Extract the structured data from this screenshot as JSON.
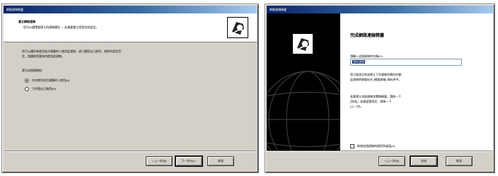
{
  "window1": {
    "title": "網路連線精靈",
    "header_title": "建立網路連線",
    "header_subtitle": "您可以選擇要建立的連線類型 — 此精靈會引導您完成設定。",
    "description_line1": "您可以讓所有使用這台電腦的人使用此連線，或只讓您自己使用，視您的設定而",
    "description_line2": "定。請選取您要如何使用此連線。",
    "group_label": "建立這個連線給：",
    "options": [
      {
        "label": "任何使用這台電腦的人使用(A)",
        "checked": true
      },
      {
        "label": "只供我自己使用(M)",
        "checked": false
      }
    ],
    "buttons": {
      "back": "< 上一步(B)",
      "next": "下一步(N) >",
      "cancel": "取消"
    }
  },
  "window2": {
    "title": "網路連線精靈",
    "heading": "完成網路連線精靈",
    "field_label": "請輸入這個連線的名稱(C):",
    "field_value": "我的連線",
    "para1_line1": "您已經成功完成建立下列連線所需的步驟：",
    "para1_line2": "此連線將會儲存在 [網路連線] 資料夾中。",
    "para2_line1": "若要建立這個連線並關閉精靈，請按一下",
    "para2_line2": "[完成]。若要變更設定，請按一下",
    "para2_line3": "[上一步]。",
    "checkbox_label": "新增這個連線的捷徑到桌面(S)",
    "buttons": {
      "back": "< 上一步(B)",
      "finish": "完成",
      "cancel": "取消"
    }
  },
  "colors": {
    "dialog_bg": "#d4d0c8",
    "titlebar_start": "#0a246a",
    "titlebar_end": "#a6caf0",
    "watermark_panel": "#000000",
    "selection": "#0a246a"
  },
  "icons": {
    "wizard": "network-wizard-icon",
    "globe": "globe-watermark-icon"
  }
}
